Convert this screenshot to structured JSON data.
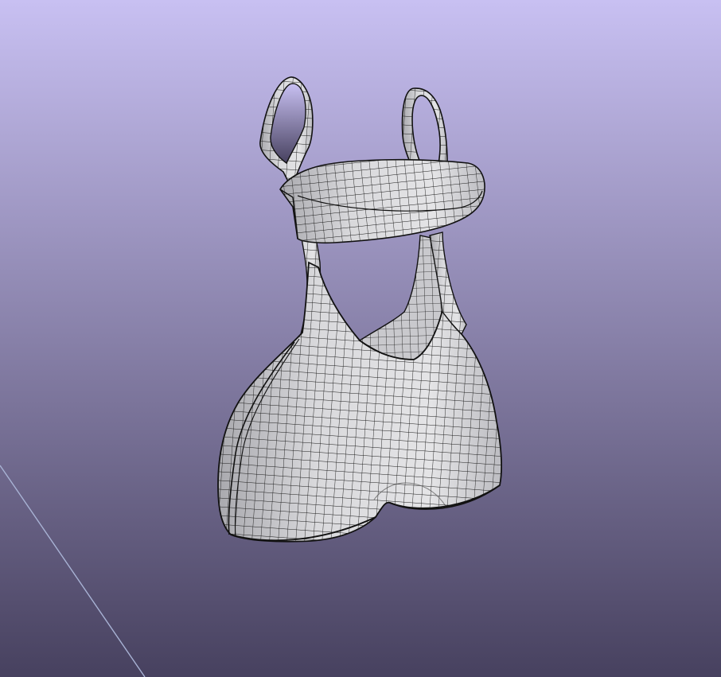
{
  "viewport": {
    "background_top": "#c8c0f2",
    "background_bottom": "#47415f",
    "axis_line_color": "#a8b2d4"
  },
  "model": {
    "icon": "garment-mesh-icon",
    "fill": "#d7d7d9",
    "fill_shade": "#b4b4b8",
    "wire": "#1a1a1a"
  }
}
